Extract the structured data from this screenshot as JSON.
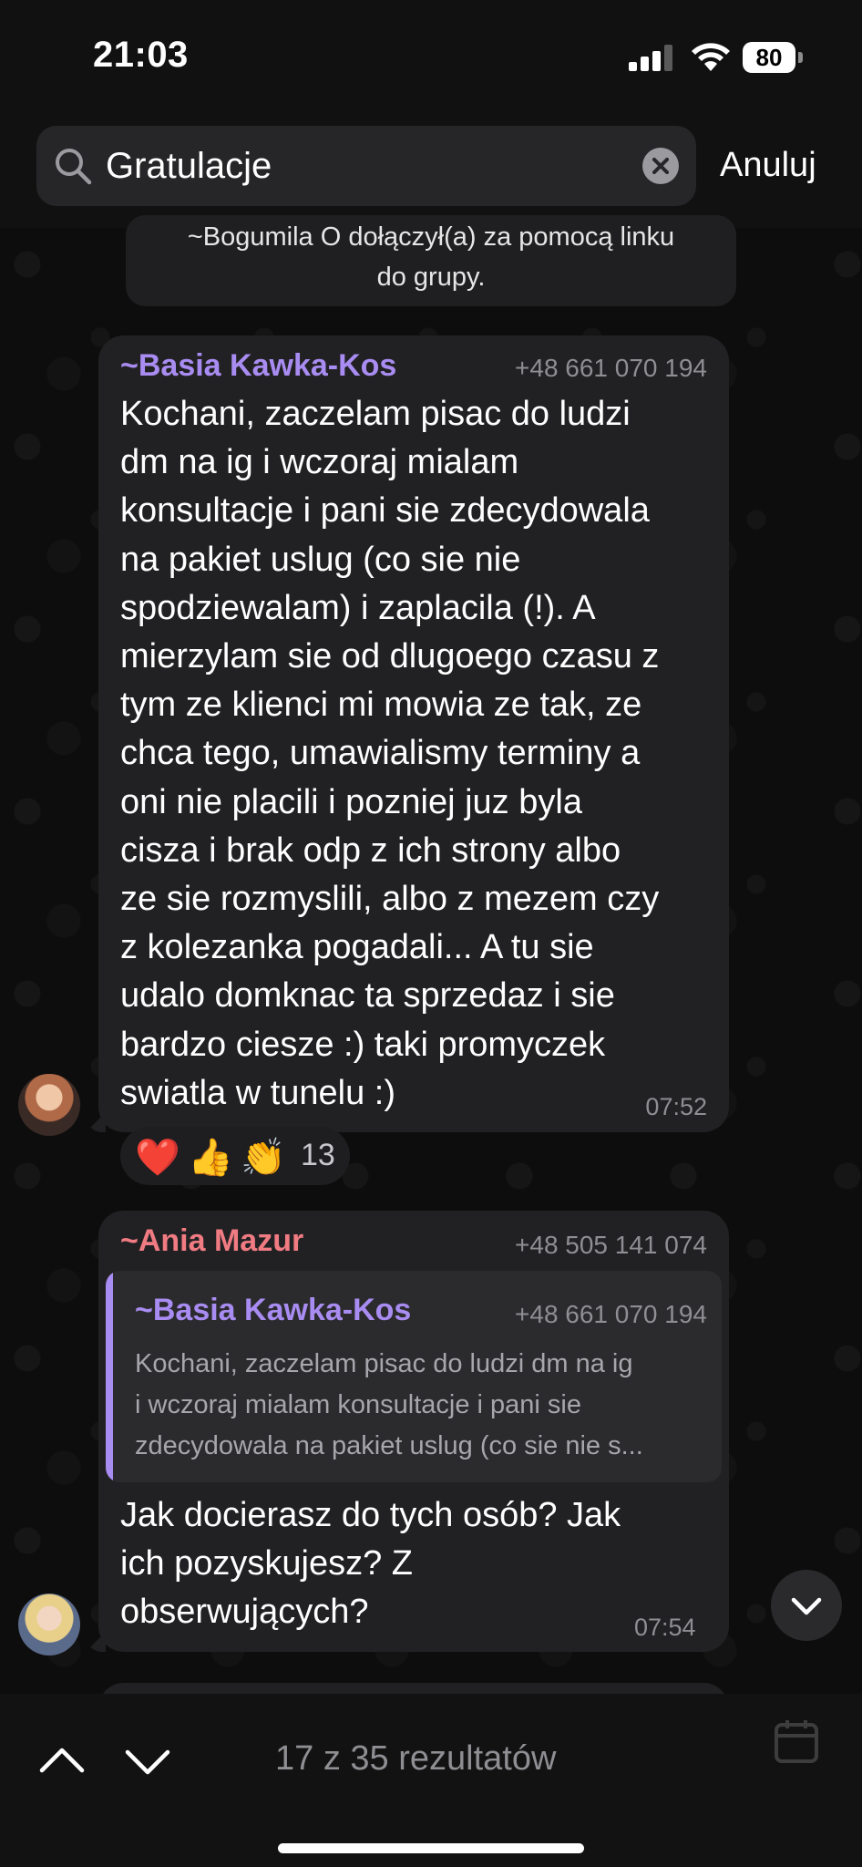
{
  "status_bar": {
    "time": "21:03",
    "battery": "80"
  },
  "search": {
    "query": "Gratulacje",
    "cancel_label": "Anuluj"
  },
  "service_message": {
    "lines": [
      "~Bogumila O dołączył(a) za pomocą linku",
      "do grupy."
    ]
  },
  "messages": [
    {
      "sender": "~Basia Kawka-Kos",
      "sender_color": "#a98cf1",
      "phone": "+48 661 070 194",
      "lines": [
        "Kochani, zaczelam pisac do ludzi",
        "dm na ig i wczoraj mialam",
        "konsultacje i pani sie zdecydowala",
        "na pakiet uslug (co sie nie",
        "spodziewalam) i zaplacila (!). A",
        "mierzylam sie od dlugoego czasu z",
        "tym ze klienci mi mowia ze tak, ze",
        "chca tego, umawialismy terminy a",
        "oni nie placili i pozniej juz byla",
        "cisza i brak odp z ich strony albo",
        "ze sie rozmyslili, albo z mezem czy",
        "z kolezanka pogadali... A tu sie",
        "udalo domknac ta sprzedaz i sie",
        "bardzo ciesze :) taki promyczek",
        "swiatla w tunelu :)"
      ],
      "time": "07:52",
      "reactions": {
        "emojis": [
          "❤️",
          "👍",
          "👏"
        ],
        "count": "13"
      }
    },
    {
      "sender": "~Ania Mazur",
      "sender_color": "#f07b82",
      "phone": "+48 505 141 074",
      "reply": {
        "sender": "~Basia Kawka-Kos",
        "phone": "+48 661 070 194",
        "lines": [
          "Kochani, zaczelam pisac do ludzi dm na ig",
          "i wczoraj mialam konsultacje i pani sie",
          "zdecydowala na pakiet uslug (co sie nie s..."
        ]
      },
      "lines": [
        "Jak docierasz do tych osób? Jak",
        "ich pozyskujesz? Z",
        "obserwujących?"
      ],
      "time": "07:54"
    }
  ],
  "footer": {
    "results": "17 z 35 rezultatów"
  },
  "icons": {
    "search": "search-icon",
    "clear": "clear-icon",
    "nav_up": "chevron-up-icon",
    "nav_down": "chevron-down-icon",
    "scroll": "chevron-down-icon",
    "calendar": "calendar-icon"
  }
}
